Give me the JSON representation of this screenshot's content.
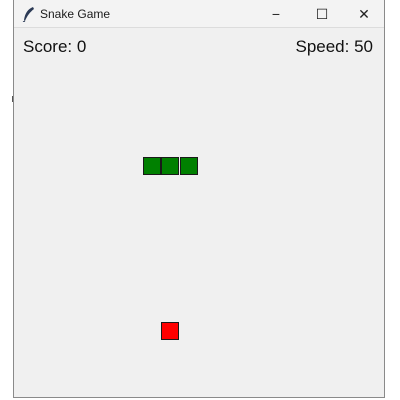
{
  "window": {
    "title": "Snake Game",
    "icon": "feather-icon",
    "controls": {
      "minimize": "−",
      "maximize": "☐",
      "close": "✕"
    }
  },
  "hud": {
    "score_label": "Score: 0",
    "speed_label": "Speed: 50"
  },
  "colors": {
    "snake": "#008000",
    "food": "#ff0000",
    "background": "#f0f0f0"
  }
}
